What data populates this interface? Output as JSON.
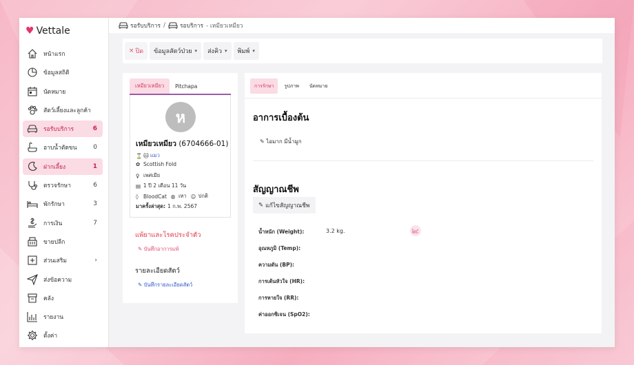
{
  "app": {
    "name": "Vettale"
  },
  "nav": [
    {
      "label": "หน้าแรก",
      "icon": "home-icon",
      "count": "",
      "active": false
    },
    {
      "label": "ข้อมูลสถิติ",
      "icon": "stats-icon",
      "count": "",
      "active": false
    },
    {
      "label": "นัดหมาย",
      "icon": "calendar-icon",
      "count": "",
      "active": false
    },
    {
      "label": "สัตว์เลี้ยงและลูกค้า",
      "icon": "paw-icon",
      "count": "",
      "active": false
    },
    {
      "label": "รอรับบริการ",
      "icon": "sofa-icon",
      "count": "6",
      "active": true
    },
    {
      "label": "อาบน้ำตัดขน",
      "icon": "bath-icon",
      "count": "0",
      "active": false
    },
    {
      "label": "ฝากเลี้ยง",
      "icon": "moon-icon",
      "count": "1",
      "active": true
    },
    {
      "label": "ตรวจรักษา",
      "icon": "stethoscope-icon",
      "count": "6",
      "active": false
    },
    {
      "label": "พักรักษา",
      "icon": "bed-icon",
      "count": "3",
      "active": false
    },
    {
      "label": "การเงิน",
      "icon": "money-icon",
      "count": "7",
      "active": false
    },
    {
      "label": "ขายปลีก",
      "icon": "register-icon",
      "count": "",
      "active": false
    },
    {
      "label": "ส่วนเสริม",
      "icon": "plus-square-icon",
      "count": "›",
      "active": false
    },
    {
      "label": "ส่งข้อความ",
      "icon": "send-icon",
      "count": "",
      "active": false
    },
    {
      "label": "คลัง",
      "icon": "box-icon",
      "count": "",
      "active": false
    },
    {
      "label": "รายงาน",
      "icon": "bar-chart-icon",
      "count": "",
      "active": false
    },
    {
      "label": "ตั้งค่า",
      "icon": "gear-icon",
      "count": "",
      "active": false
    }
  ],
  "breadcrumb": {
    "first": "รอรับบริการ",
    "sep": "/",
    "second": "รอบริการ",
    "current": "- เหมียวเหมียว"
  },
  "toolbar": {
    "close": "ปิด",
    "close_icon": "×",
    "pet_info": "ข้อมูลสัตว์ป่วย",
    "queue": "ส่งคิว",
    "print": "พิมพ์"
  },
  "pet_card": {
    "tabs": [
      "เหมียวเหมียว",
      "Pitchapa"
    ],
    "avatar_letter": "ห",
    "name": "เหมียวเหมียว",
    "code": "(6704666-01)",
    "species_emoji": "🐱",
    "species": "แมว",
    "breed": "Scottish Fold",
    "sex": "เพศเมีย",
    "age": "1 ปี 2 เดือน 11 วัน",
    "blood": "BloodCat",
    "color": "เทา",
    "status": "ปกติ",
    "last_visit_label": "มาครั้งล่าสุด:",
    "last_visit": "1 ก.พ. 2567"
  },
  "allergy": {
    "title": "แพ้ยาและโรคประจำตัว",
    "link": "บันทึกอาการแพ้"
  },
  "pet_detail": {
    "title": "รายละเอียดสัตว์",
    "link": "บันทึกรายละเอียดสัตว์"
  },
  "detail": {
    "tabs": [
      "การรักษา",
      "รูปภาพ",
      "นัดหมาย"
    ],
    "symptom_title": "อาการเบื้องต้น",
    "symptom": "ไอมาก มีน้ำมูก",
    "vital_title": "สัญญาณชีพ",
    "vital_button": "แก้ไขสัญญาณชีพ",
    "vitals": [
      {
        "label": "น้ำหนัก (Weight):",
        "value": "3.2 kg."
      },
      {
        "label": "อุณหภูมิ (Temp):",
        "value": ""
      },
      {
        "label": "ความดัน (BP):",
        "value": ""
      },
      {
        "label": "การเต้นหัวใจ (HR):",
        "value": ""
      },
      {
        "label": "การหายใจ (RR):",
        "value": ""
      },
      {
        "label": "ค่าออกซิเจน (SpO2):",
        "value": ""
      }
    ]
  },
  "colors": {
    "accent": "#e4366c",
    "active_bg": "#fbdbe4",
    "link_blue": "#2f55c9"
  }
}
